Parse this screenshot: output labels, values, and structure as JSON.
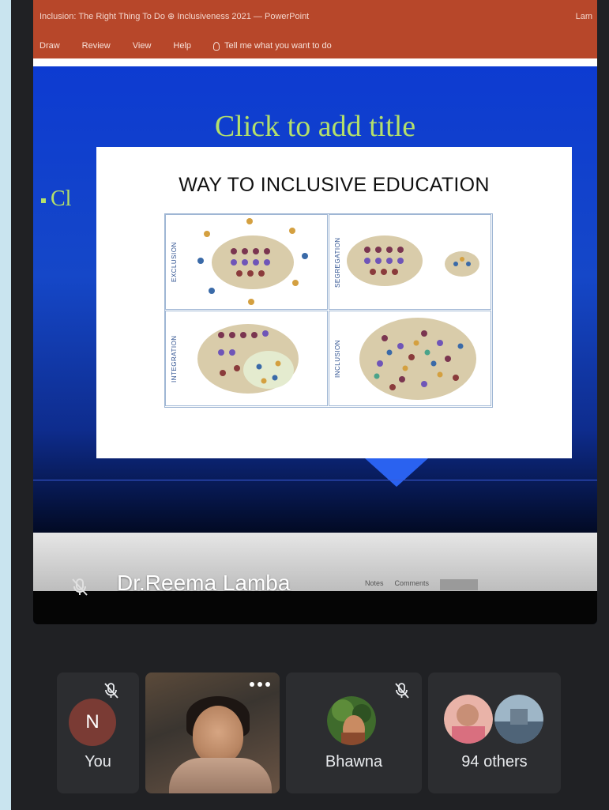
{
  "powerpoint": {
    "window_title": "Inclusion: The Right Thing To Do ⊕ Inclusiveness 2021 — PowerPoint",
    "window_title_right": "Lam",
    "ribbon_tabs": [
      "Draw",
      "Review",
      "View",
      "Help"
    ],
    "tell_me": "Tell me what you want to do"
  },
  "slide": {
    "placeholder_title": "Click to add title",
    "bullet_fragment": "Cl",
    "card_title": "WAY  TO INCLUSIVE EDUCATION",
    "quadrant_labels": [
      "EXCLUSION",
      "SEGREGATION",
      "INTEGRATION",
      "INCLUSION"
    ]
  },
  "presenter": {
    "name": "Dr.Reema Lamba",
    "status_items": [
      "Notes",
      "Comments"
    ]
  },
  "participants": [
    {
      "name": "You",
      "initial": "N",
      "muted": true
    },
    {
      "name": "",
      "video": true
    },
    {
      "name": "Bhawna",
      "muted": true
    },
    {
      "name": "94 others"
    }
  ],
  "colors": {
    "ppt_red": "#b7472a",
    "slide_blue": "#1547c8",
    "title_green": "#b4e06a",
    "meet_bg": "#202124",
    "tile_bg": "#2c2d30",
    "avatar_n": "#7a3b34"
  }
}
